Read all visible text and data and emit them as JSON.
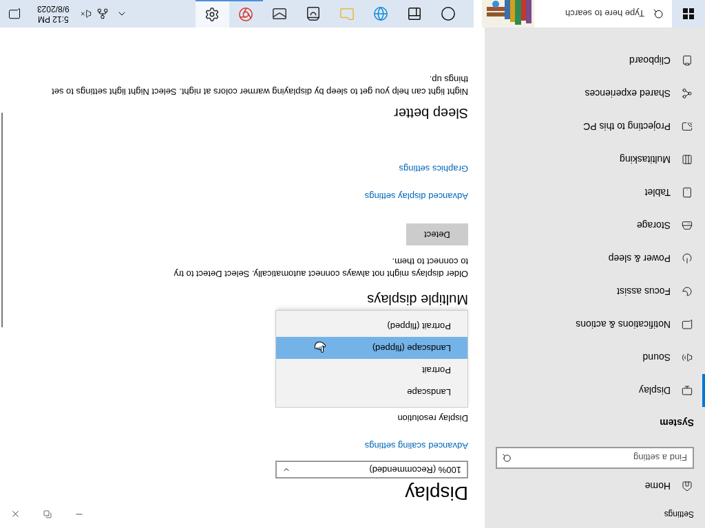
{
  "window": {
    "title": "Settings"
  },
  "sidebar": {
    "home": "Home",
    "search": {
      "placeholder": "Find a setting"
    },
    "section": "System",
    "items": [
      {
        "label": "Display",
        "kind": "display",
        "selected": true
      },
      {
        "label": "Sound",
        "kind": "sound",
        "selected": false
      },
      {
        "label": "Notifications & actions",
        "kind": "notifications",
        "selected": false
      },
      {
        "label": "Focus assist",
        "kind": "focus",
        "selected": false
      },
      {
        "label": "Power & sleep",
        "kind": "power",
        "selected": false
      },
      {
        "label": "Storage",
        "kind": "storage",
        "selected": false
      },
      {
        "label": "Tablet",
        "kind": "tablet",
        "selected": false
      },
      {
        "label": "Multitasking",
        "kind": "multitasking",
        "selected": false
      },
      {
        "label": "Projecting to this PC",
        "kind": "projecting",
        "selected": false
      },
      {
        "label": "Shared experiences",
        "kind": "shared",
        "selected": false
      },
      {
        "label": "Clipboard",
        "kind": "clipboard",
        "selected": false
      }
    ]
  },
  "content": {
    "title": "Display",
    "scale": {
      "value": "100% (Recommended)"
    },
    "scaling_link": "Advanced scaling settings",
    "resolution_label": "Display resolution",
    "orientation_menu": [
      {
        "label": "Landscape",
        "selected": false
      },
      {
        "label": "Portrait",
        "selected": false
      },
      {
        "label": "Landscape (flipped)",
        "selected": true
      },
      {
        "label": "Portrait (flipped)",
        "selected": false
      }
    ],
    "multiple_displays": {
      "heading": "Multiple displays",
      "text": "Older displays might not always connect automatically. Select Detect to try to connect to them.",
      "button": "Detect"
    },
    "links": [
      "Advanced display settings",
      "Graphics settings"
    ],
    "sleep_better": {
      "heading": "Sleep better",
      "text": "Night light can help you get to sleep by displaying warmer colors at night. Select Night light settings to set things up."
    }
  },
  "taskbar": {
    "search": {
      "placeholder": "Type here to search"
    },
    "apps": [
      {
        "kind": "cortana",
        "running": false,
        "selected": false
      },
      {
        "kind": "taskview",
        "running": false,
        "selected": false
      },
      {
        "kind": "edge",
        "running": false,
        "selected": false
      },
      {
        "kind": "explorer",
        "running": false,
        "selected": false
      },
      {
        "kind": "store",
        "running": false,
        "selected": false
      },
      {
        "kind": "mail",
        "running": false,
        "selected": false
      },
      {
        "kind": "chrome",
        "running": true,
        "selected": false
      },
      {
        "kind": "settings",
        "running": true,
        "selected": true
      }
    ],
    "time": "5:12 PM",
    "date": "9/8/2023"
  }
}
